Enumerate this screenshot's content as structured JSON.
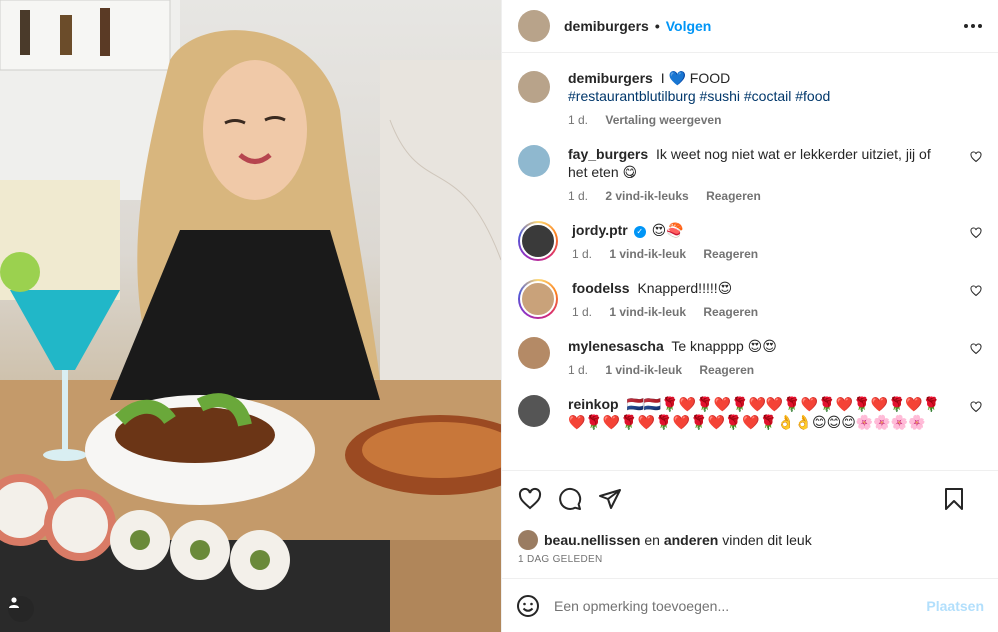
{
  "post": {
    "author": "demiburgers",
    "follow_label": "Volgen",
    "caption_text": "I 💙 FOOD",
    "hashtags": [
      "#restaurantblutilburg",
      "#sushi",
      "#coctail",
      "#food"
    ],
    "age": "1 d.",
    "translate_label": "Vertaling weergeven"
  },
  "comments": [
    {
      "user": "fay_burgers",
      "text": "Ik weet nog niet wat er lekkerder uitziet, jij of het eten 😋",
      "age": "1 d.",
      "likes": "2 vind-ik-leuks",
      "reply": "Reageren",
      "story": false,
      "avatar_color": "#8fb8cf"
    },
    {
      "user": "jordy.ptr",
      "text": "😍🍣",
      "age": "1 d.",
      "likes": "1 vind-ik-leuk",
      "reply": "Reageren",
      "story": true,
      "verified": true,
      "avatar_color": "#3a3a3a"
    },
    {
      "user": "foodelss",
      "text": "Knapperd!!!!!😍",
      "age": "1 d.",
      "likes": "1 vind-ik-leuk",
      "reply": "Reageren",
      "story": true,
      "avatar_color": "#c9a27a"
    },
    {
      "user": "mylenesascha",
      "text": "Te knapppp 😍😍",
      "age": "1 d.",
      "likes": "1 vind-ik-leuk",
      "reply": "Reageren",
      "story": false,
      "avatar_color": "#b48a66"
    },
    {
      "user": "reinkop",
      "text": "🇳🇱🇳🇱🌹❤️🌹❤️🌹❤️❤️🌹❤️🌹❤️🌹❤️🌹❤️🌹❤️🌹❤️🌹❤️🌹❤️🌹❤️🌹❤️🌹👌👌😊😊😊🌸🌸🌸🌸",
      "story": false,
      "avatar_color": "#555"
    }
  ],
  "footer": {
    "liked_by_user": "beau.nellissen",
    "liked_joiner": "en",
    "liked_others": "anderen",
    "liked_suffix": "vinden dit leuk",
    "date": "1 DAG GELEDEN",
    "comment_placeholder": "Een opmerking toevoegen...",
    "post_label": "Plaatsen"
  },
  "icons": [
    "more-icon",
    "heart-icon",
    "comment-icon",
    "share-icon",
    "bookmark-icon",
    "emoji-icon",
    "user-tag-icon"
  ]
}
